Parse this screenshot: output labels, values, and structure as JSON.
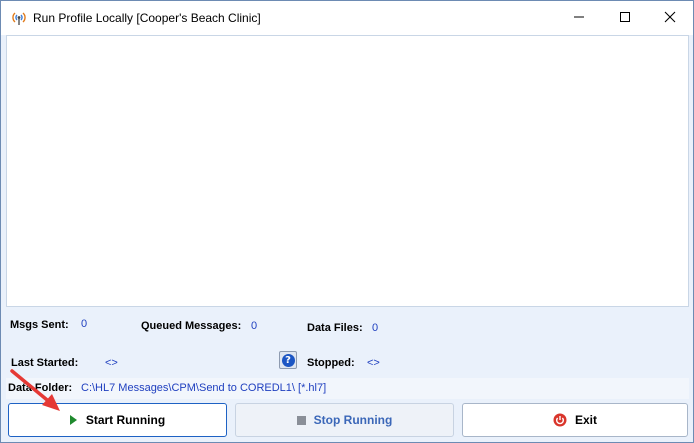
{
  "window": {
    "title": "Run Profile Locally [Cooper's Beach Clinic]",
    "app_icon": "antenna-broadcast-icon"
  },
  "stats": {
    "msgs_sent_label": "Msgs Sent:",
    "msgs_sent_value": "0",
    "queued_label": "Queued Messages:",
    "queued_value": "0",
    "data_files_label": "Data Files:",
    "data_files_value": "0",
    "last_started_label": "Last Started:",
    "last_started_value": "<>",
    "stopped_label": "Stopped:",
    "stopped_value": "<>"
  },
  "data_folder": {
    "label": "Data Folder:",
    "value": "C:\\HL7 Messages\\CPM\\Send to COREDL1\\ [*.hl7]"
  },
  "buttons": {
    "start": "Start Running",
    "stop": "Stop Running",
    "exit": "Exit"
  },
  "colors": {
    "accent": "#1e62c4",
    "value_text": "#1f3fbf",
    "annotation_arrow": "#e53935"
  }
}
